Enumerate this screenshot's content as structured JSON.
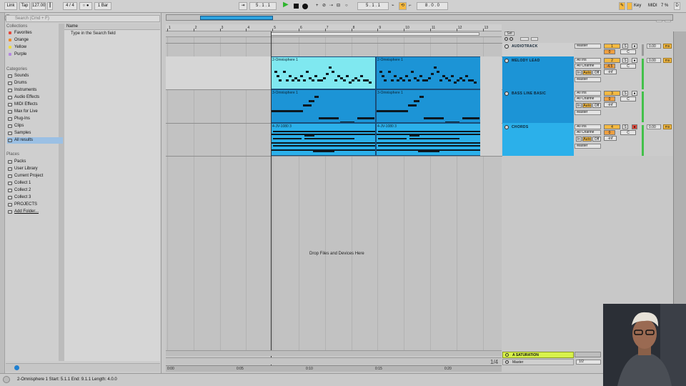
{
  "transport": {
    "link": "Link",
    "tap": "Tap",
    "tempo": "127.00",
    "sig_num": "4",
    "sig_sep": "/",
    "sig_den": "4",
    "metro": "○ ●",
    "quant": "1 Bar",
    "position": "5 .   1 .   1",
    "end_position": "5 .   1 .   1",
    "length": "8 .   0 .   0",
    "key": "Key",
    "midi": "MIDI",
    "cpu": "7 %",
    "d": "D",
    "w": "W"
  },
  "browser": {
    "search_placeholder": "Search (Cmd + F)",
    "collections_title": "Collections",
    "collections": [
      {
        "label": "Favorites",
        "color": "#e5473a"
      },
      {
        "label": "Orange",
        "color": "#f28c28"
      },
      {
        "label": "Yellow",
        "color": "#f2dd3a"
      },
      {
        "label": "Purple",
        "color": "#b487e0"
      }
    ],
    "categories_title": "Categories",
    "categories": [
      {
        "label": "Sounds",
        "icon": "sounds-icon"
      },
      {
        "label": "Drums",
        "icon": "drums-icon"
      },
      {
        "label": "Instruments",
        "icon": "instruments-icon"
      },
      {
        "label": "Audio Effects",
        "icon": "audio-effects-icon"
      },
      {
        "label": "MIDI Effects",
        "icon": "midi-effects-icon"
      },
      {
        "label": "Max for Live",
        "icon": "max-for-live-icon"
      },
      {
        "label": "Plug-Ins",
        "icon": "plugins-icon"
      },
      {
        "label": "Clips",
        "icon": "clips-icon"
      },
      {
        "label": "Samples",
        "icon": "samples-icon"
      },
      {
        "label": "All results",
        "icon": "all-results-icon",
        "selected": true
      }
    ],
    "places_title": "Places",
    "places": [
      {
        "label": "Packs"
      },
      {
        "label": "User Library"
      },
      {
        "label": "Current Project"
      },
      {
        "label": "Collect 1"
      },
      {
        "label": "Collect 2"
      },
      {
        "label": "Collect 3"
      },
      {
        "label": "PROJECTS"
      },
      {
        "label": "Add Folder..."
      }
    ],
    "name_header": "Name",
    "hint": "Type in the Search field"
  },
  "ruler": {
    "bars": [
      "1",
      "2",
      "3",
      "4",
      "5",
      "6",
      "7",
      "8",
      "9",
      "10",
      "11",
      "12",
      "13"
    ]
  },
  "set_label": "Set",
  "tracks": [
    {
      "name": "AUDIOTRACK",
      "input": "Master",
      "number": "1",
      "activator": "0",
      "pan": "C",
      "volume": "0.00",
      "ms": "ms"
    },
    {
      "name": "MELODY LEAD",
      "input": "All Ins",
      "channel": "All Channe",
      "in": "In",
      "auto": "Auto",
      "off": "Off",
      "output": "Master",
      "number": "2",
      "activator": "-4.5",
      "pan": "C",
      "vol_level": "-inf",
      "volume": "0.00",
      "ms": "ms",
      "clips": [
        {
          "label": "2-Omnisphere 1"
        },
        {
          "label": "2-Omnisphere 1"
        }
      ]
    },
    {
      "name": "BASS LINE BASIC",
      "input": "All Ins",
      "channel": "All Channe",
      "in": "In",
      "auto": "Auto",
      "off": "Off",
      "output": "Master",
      "number": "3",
      "activator": "0",
      "pan": "C",
      "vol_level": "-inf",
      "clips": [
        {
          "label": "3-Omnisphere 1"
        },
        {
          "label": "3-Omnisphere 1"
        }
      ]
    },
    {
      "name": "CHORDS",
      "input": "All Ins",
      "channel": "All Channe",
      "in": "In",
      "auto": "Auto",
      "off": "Off",
      "output": "Master",
      "number": "4",
      "activator": "0",
      "pan": "C",
      "vol_level": "-inf",
      "volume": "0.00",
      "ms": "ms",
      "clips": [
        {
          "label": "4-JV-1080 3"
        },
        {
          "label": "4-JV-1080 3"
        }
      ]
    }
  ],
  "drop_message": "Drop Files and Devices Here",
  "return": {
    "name": "A SATURATION",
    "master_label": "Master",
    "master_value": "1/2",
    "page": "1/4"
  },
  "timeline": {
    "marks": [
      "0:00",
      "0:05",
      "0:10",
      "0:15",
      "0:20"
    ]
  },
  "status": {
    "text": "2-Omnisphere 1  Start: 5.1.1  End: 9.1.1  Length: 4.0.0"
  },
  "colors": {
    "clip_selected": "#7fe8f0",
    "clip_blue": "#1c94d6",
    "clip_chords": "#2bb0ea",
    "track_header": "#1c94d6",
    "accent_orange": "#f4b942",
    "return_yellow": "#d8f24a"
  }
}
